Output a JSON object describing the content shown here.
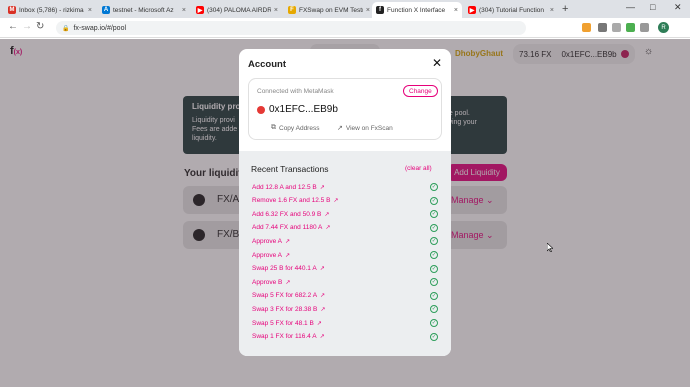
{
  "browser": {
    "tabs": [
      {
        "title": "Inbox (5,786) - rizkima",
        "favicon": "gmail-icon",
        "color": "#d93025",
        "glyph": "M"
      },
      {
        "title": "testnet - Microsoft Az",
        "favicon": "azure-icon",
        "color": "#0078d4",
        "glyph": "A"
      },
      {
        "title": "(304) PALOMA AIRDR",
        "favicon": "youtube-icon",
        "color": "#ff0000",
        "glyph": "▶"
      },
      {
        "title": "FXSwap on EVM Testn",
        "favicon": "fxswap-icon",
        "color": "#e6a800",
        "glyph": "F"
      },
      {
        "title": "Function X Interface",
        "favicon": "functionx-icon",
        "color": "#222222",
        "glyph": "f"
      },
      {
        "title": "(304) Tutorial Function",
        "favicon": "youtube-icon",
        "color": "#ff0000",
        "glyph": "▶"
      }
    ],
    "url": "fx-swap.io/#/pool",
    "profile_initial": "R"
  },
  "app": {
    "logo_text": "f",
    "logo_sub": "(x)",
    "ticker": "DhobyGhaut",
    "balance": "73.16 FX",
    "account_short": "0x1EFC...EB9b",
    "info_title": "Liquidity pro",
    "info_body_left": "Liquidity provi\nFees are adde\nliquidity.",
    "info_body_right": "the pool.\nawing your",
    "your_liquidity": "Your liquidit",
    "add_liquidity": "Add Liquidity",
    "pools": [
      {
        "pair": "FX/A",
        "manage": "Manage"
      },
      {
        "pair": "FX/B",
        "manage": "Manage"
      }
    ]
  },
  "modal": {
    "title": "Account",
    "connected_with": "Connected with MetaMask",
    "change_label": "Change",
    "address": "0x1EFC...EB9b",
    "copy_label": "Copy Address",
    "view_label": "View on FxScan",
    "recent_title": "Recent Transactions",
    "clear_label": "(clear all)",
    "transactions": [
      "Add 12.8 A and 12.5 B",
      "Remove 1.6 FX and 12.5 B",
      "Add 6.32 FX and 50.9 B",
      "Add 7.44 FX and 1180 A",
      "Approve A",
      "Approve A",
      "Swap 25 B for 440.1 A",
      "Approve B",
      "Swap 5 FX for 682.2 A",
      "Swap 3 FX for 28.38 B",
      "Swap 5 FX for 48.1 B",
      "Swap 1 FX for 116.4 A"
    ]
  },
  "colors": {
    "accent": "#e6007a",
    "success": "#2e9e5b",
    "info_bg": "#1f3b3a"
  }
}
